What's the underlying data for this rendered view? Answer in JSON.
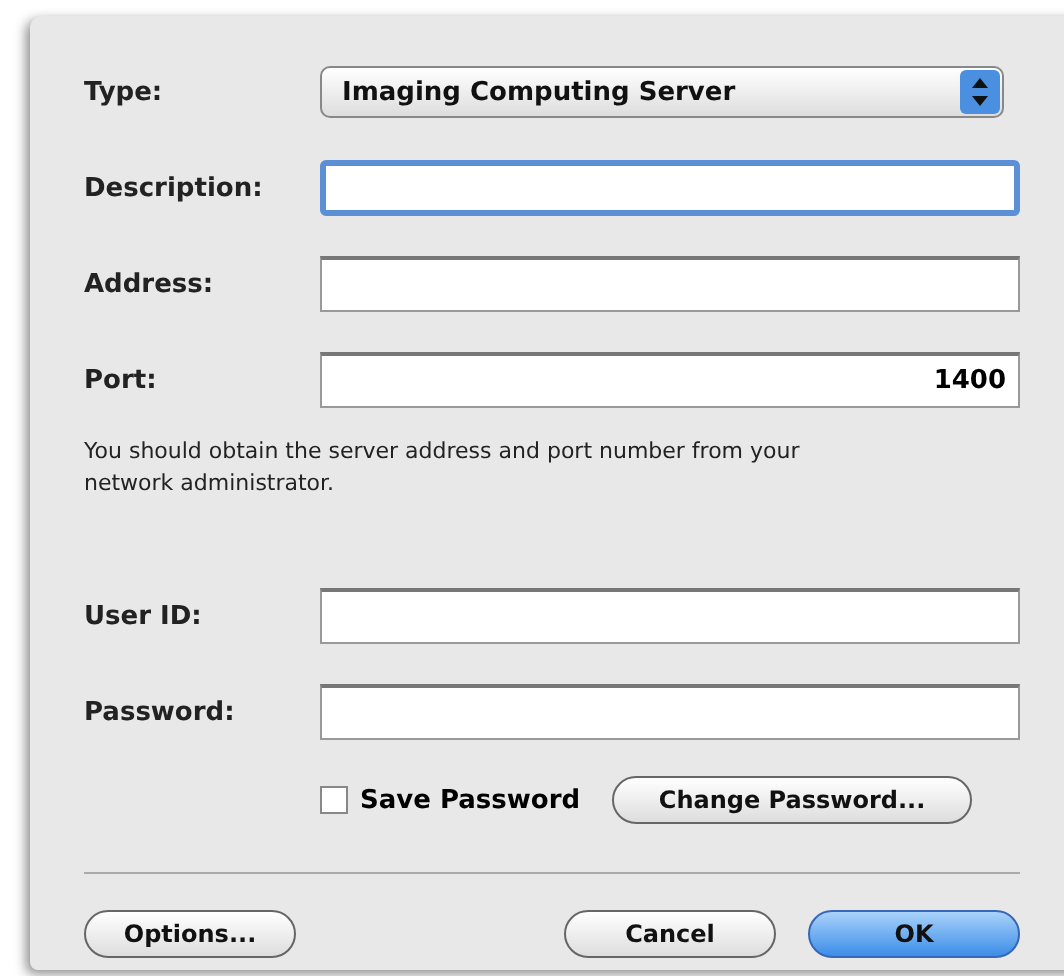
{
  "fields": [
    {
      "label": "Type:",
      "kind": "select",
      "value": "Imaging Computing Server",
      "focused": false
    },
    {
      "label": "Description:",
      "kind": "text",
      "focused": true
    },
    {
      "label": "Address:",
      "kind": "text",
      "focused": false
    },
    {
      "label": "Port:",
      "kind": "number",
      "value": "1400",
      "focused": false
    }
  ],
  "note": "You should obtain the server address and port number from your network administrator.",
  "credentials": [
    {
      "label": "User ID:",
      "focused": false
    },
    {
      "label": "Password:",
      "focused": false
    }
  ],
  "save_password": {
    "label": "Save Password",
    "checked": false
  },
  "change_password_button": "Change Password...",
  "buttons": [
    {
      "label": "Options...",
      "default": false
    },
    {
      "label": "Cancel",
      "default": false
    },
    {
      "label": "OK",
      "default": true
    }
  ]
}
